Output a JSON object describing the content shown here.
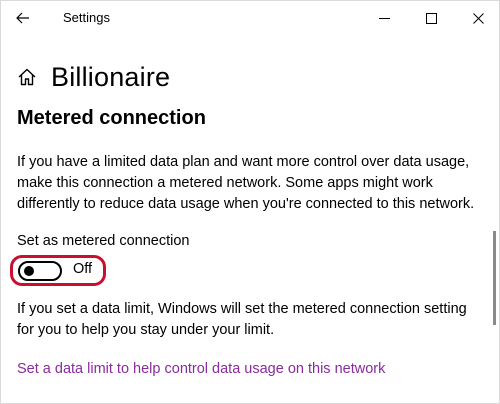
{
  "window": {
    "title": "Settings"
  },
  "header": {
    "page_title": "Billionaire"
  },
  "section": {
    "title": "Metered connection",
    "description": "If you have a limited data plan and want more control over data usage, make this connection a metered network. Some apps might work differently to reduce data usage when you're connected to this network."
  },
  "metered_toggle": {
    "label": "Set as metered connection",
    "state_text": "Off",
    "is_on": false
  },
  "data_limit": {
    "description": "If you set a data limit, Windows will set the metered connection setting for you to help you stay under your limit.",
    "link_text": "Set a data limit to help control data usage on this network"
  },
  "colors": {
    "link": "#8a2b9e",
    "highlight": "#c8102e"
  },
  "icons": {
    "back": "back-arrow-icon",
    "minimize": "minimize-icon",
    "maximize": "maximize-icon",
    "close": "close-icon",
    "home": "home-icon"
  }
}
